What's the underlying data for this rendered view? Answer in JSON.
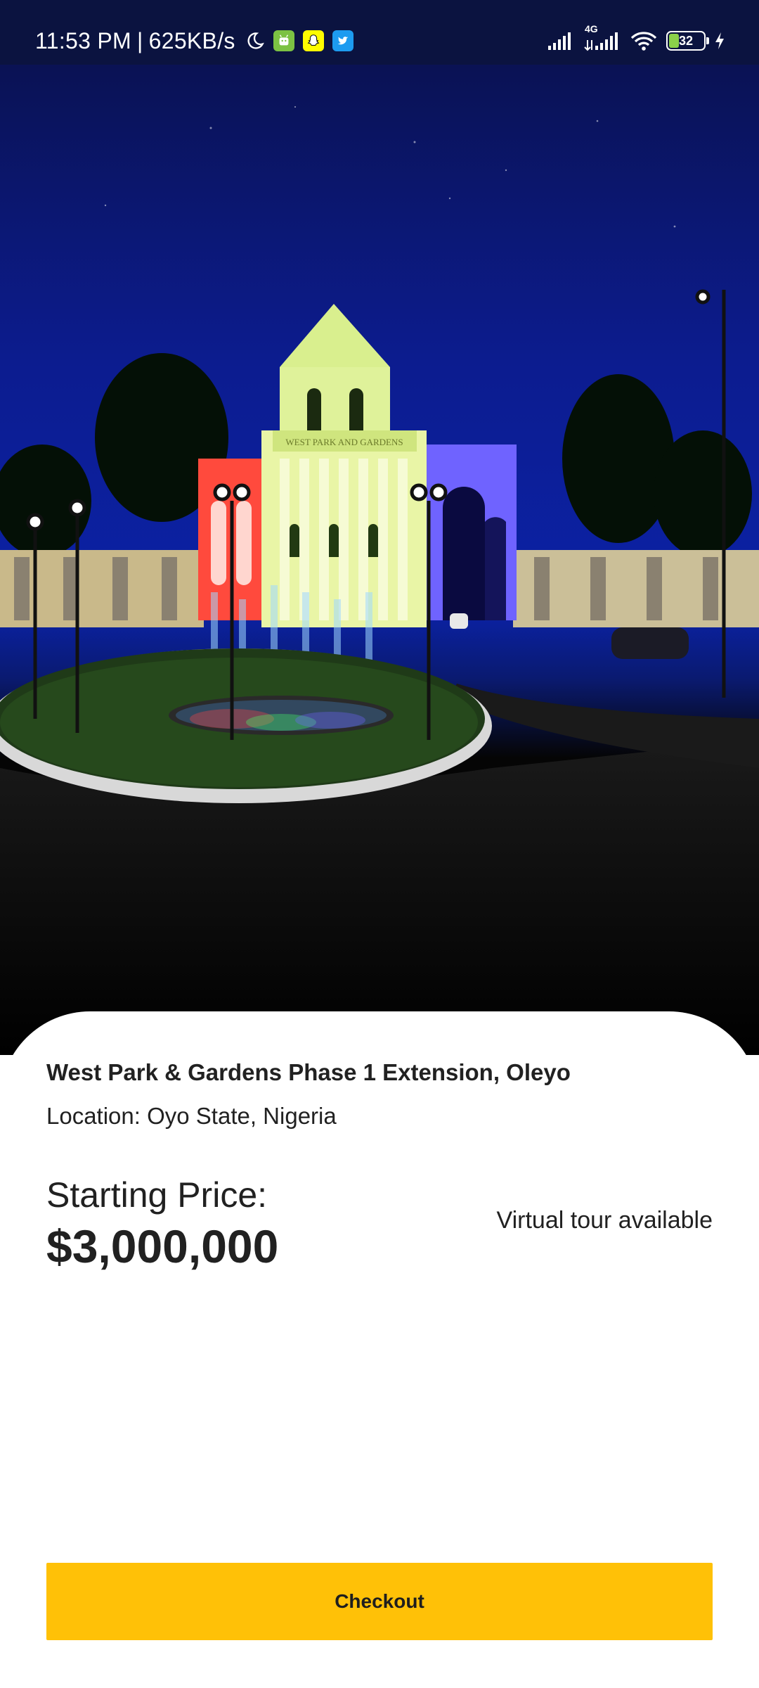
{
  "status_bar": {
    "time": "11:53 PM",
    "separator": "|",
    "net_speed": "625KB/s",
    "network_type": "4G",
    "battery_level": "32",
    "battery_fraction": 0.32,
    "icons": [
      "moon-icon",
      "android-app-icon",
      "snapchat-icon",
      "twitter-icon",
      "signal-icon",
      "signal-4g-icon",
      "wifi-icon",
      "battery-icon",
      "charging-icon"
    ]
  },
  "hero": {
    "description_icon": "estate-gate-image",
    "gate_sign": "WEST PARK AND GARDENS"
  },
  "listing": {
    "title": "West Park & Gardens Phase 1 Extension, Oleyo",
    "location": "Location: Oyo State, Nigeria",
    "price_label": "Starting Price:",
    "price_value": "$3,000,000",
    "virtual_tour": "Virtual tour available"
  },
  "actions": {
    "checkout_label": "Checkout"
  },
  "colors": {
    "accent": "#ffc107",
    "text": "#212121",
    "status_bar_bg": "#0b1340",
    "sheet_bg": "#ffffff"
  }
}
